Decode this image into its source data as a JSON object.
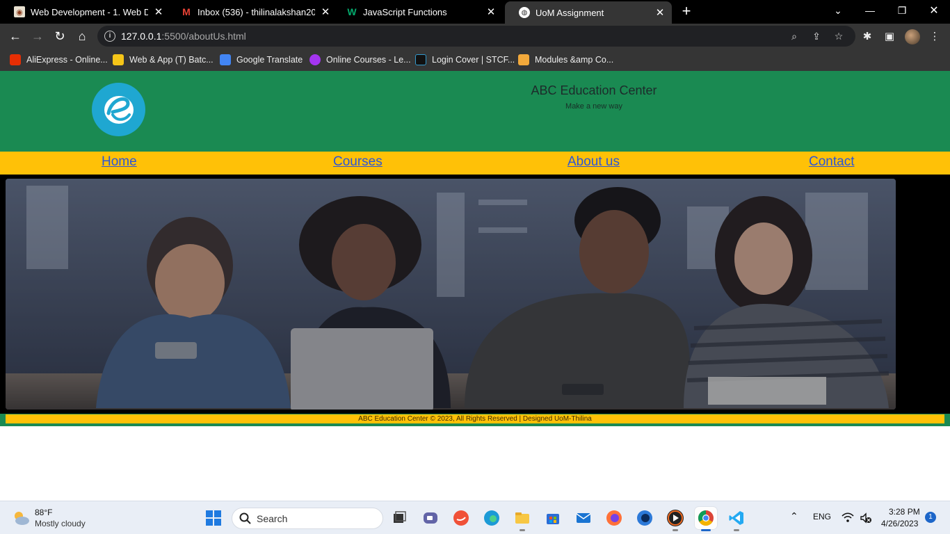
{
  "browser": {
    "tabs": [
      {
        "title": "Web Development - 1. Web Desi",
        "active": false
      },
      {
        "title": "Inbox (536) - thilinalakshan20002",
        "active": false
      },
      {
        "title": "JavaScript Functions",
        "active": false
      },
      {
        "title": "UoM Assignment",
        "active": true
      }
    ],
    "url_host": "127.0.0.1",
    "url_path": ":5500/aboutUs.html",
    "bookmarks": [
      {
        "label": "AliExpress - Online..."
      },
      {
        "label": "Web & App (T) Batc..."
      },
      {
        "label": "Google Translate"
      },
      {
        "label": "Online Courses - Le..."
      },
      {
        "label": "Login Cover | STCF..."
      },
      {
        "label": "Modules &amp Co..."
      }
    ]
  },
  "site": {
    "title": "ABC Education Center",
    "tagline": "Make a new way",
    "nav": [
      {
        "label": "Home"
      },
      {
        "label": "Courses"
      },
      {
        "label": "About us"
      },
      {
        "label": "Contact"
      }
    ],
    "footer": "ABC Education Center © 2023, All Rights Reserved | Designed UoM-Thilina",
    "colors": {
      "header": "#1a8a52",
      "nav": "#ffc107",
      "link": "#2b55d8",
      "logo": "#1fa7d1"
    }
  },
  "taskbar": {
    "weather_temp": "88°F",
    "weather_desc": "Mostly cloudy",
    "search_label": "Search",
    "language": "ENG",
    "time": "3:28 PM",
    "date": "4/26/2023",
    "notifications": "1"
  }
}
